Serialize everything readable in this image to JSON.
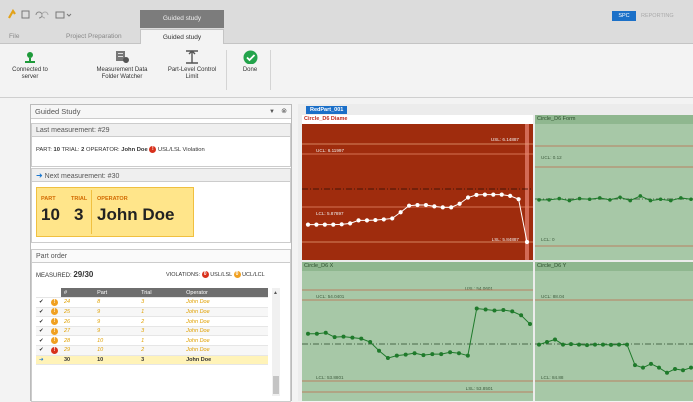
{
  "tabs": {
    "file": "File",
    "project": "Project Preparation",
    "guided_top": "Guided study",
    "guided_active": "Guided study"
  },
  "topright": {
    "spc": "SPC",
    "reporting": "REPORTING"
  },
  "ribbon": {
    "connected": "Connected to server",
    "watcher": "Measurement Data Folder Watcher",
    "limit": "Part-Level Control Limit",
    "done": "Done"
  },
  "guided": {
    "title": "Guided Study",
    "last_label": "Last measurement: #29",
    "last": {
      "part_k": "PART:",
      "part_v": "10",
      "trial_k": "TRIAL:",
      "trial_v": "2",
      "op_k": "OPERATOR:",
      "op_v": "John Doe",
      "violation": "USL/LSL Violation"
    },
    "next_label": "Next measurement: #30",
    "next": {
      "part_k": "PART",
      "trial_k": "TRIAL",
      "op_k": "OPERATOR",
      "part_v": "10",
      "trial_v": "3",
      "op_v": "John Doe"
    },
    "order_title": "Part order",
    "measured_k": "MEASURED:",
    "measured_v": "29/30",
    "violations_k": "VIOLATIONS:",
    "viol_red_n": "0",
    "viol_red_t": "USL/LSL",
    "viol_or_n": "0",
    "viol_or_t": "UCL/LCL",
    "cols": [
      "#",
      "Part",
      "Trial",
      "Operator"
    ],
    "rows": [
      {
        "n": "24",
        "part": "8",
        "trial": "3",
        "op": "John Doe",
        "badge": "orange"
      },
      {
        "n": "25",
        "part": "9",
        "trial": "1",
        "op": "John Doe",
        "badge": "orange"
      },
      {
        "n": "26",
        "part": "9",
        "trial": "2",
        "op": "John Doe",
        "badge": "orange"
      },
      {
        "n": "27",
        "part": "9",
        "trial": "3",
        "op": "John Doe",
        "badge": "orange"
      },
      {
        "n": "28",
        "part": "10",
        "trial": "1",
        "op": "John Doe",
        "badge": "orange"
      },
      {
        "n": "29",
        "part": "10",
        "trial": "2",
        "op": "John Doe",
        "badge": "red"
      },
      {
        "n": "30",
        "part": "10",
        "trial": "3",
        "op": "John Doe",
        "badge": "next"
      }
    ]
  },
  "tag": "RedPart_001",
  "charts": {
    "c1": {
      "title": "Circle_D6 Diame",
      "usl": "USL: 6.14887",
      "ucl": "UCL: 6.11997",
      "lcl": "LCL: 5.87897",
      "lsl": "LSL: 5.84887"
    },
    "c2": {
      "title": "Circle_D6 Form",
      "ucl": "UCL: 0.12",
      "lcl": "LCL: 0"
    },
    "c3": {
      "title": "Circle_D6 X",
      "usl": "USL: 54.0601",
      "ucl": "UCL: 54.0401",
      "lcl": "LCL: 53.8801",
      "lsl": "LSL: 53.8501"
    },
    "c4": {
      "title": "Circle_D6 Y",
      "ucl": "UCL: 88.04",
      "lcl": "LCL: 84.88"
    }
  },
  "chart_data": [
    {
      "type": "line",
      "title": "Circle_D6 Diame",
      "y": [
        5.902,
        5.902,
        5.902,
        5.902,
        5.903,
        5.906,
        5.915,
        5.915,
        5.916,
        5.918,
        5.921,
        5.94,
        5.96,
        5.962,
        5.962,
        5.958,
        5.955,
        5.955,
        5.966,
        5.985,
        5.993,
        5.994,
        5.994,
        5.994,
        5.99,
        5.98,
        5.84887
      ]
    },
    {
      "type": "line",
      "title": "Circle_D6 Form",
      "y": [
        0.07,
        0.07,
        0.072,
        0.069,
        0.072,
        0.071,
        0.073,
        0.07,
        0.074,
        0.069,
        0.076,
        0.069,
        0.071,
        0.069,
        0.073,
        0.071
      ]
    },
    {
      "type": "line",
      "title": "Circle_D6 X",
      "y": [
        53.97,
        53.97,
        53.972,
        53.963,
        53.964,
        53.962,
        53.96,
        53.953,
        53.935,
        53.92,
        53.925,
        53.927,
        53.93,
        53.926,
        53.928,
        53.928,
        53.932,
        53.93,
        53.925,
        54.022,
        54.02,
        54.018,
        54.019,
        54.016,
        54.008,
        53.99
      ]
    },
    {
      "type": "line",
      "title": "Circle_D6 Y",
      "y": [
        86.3,
        86.4,
        86.5,
        86.3,
        86.32,
        86.3,
        86.28,
        86.3,
        86.3,
        86.29,
        86.3,
        86.3,
        85.5,
        85.4,
        85.55,
        85.4,
        85.2,
        85.35,
        85.3,
        85.4
      ]
    }
  ]
}
